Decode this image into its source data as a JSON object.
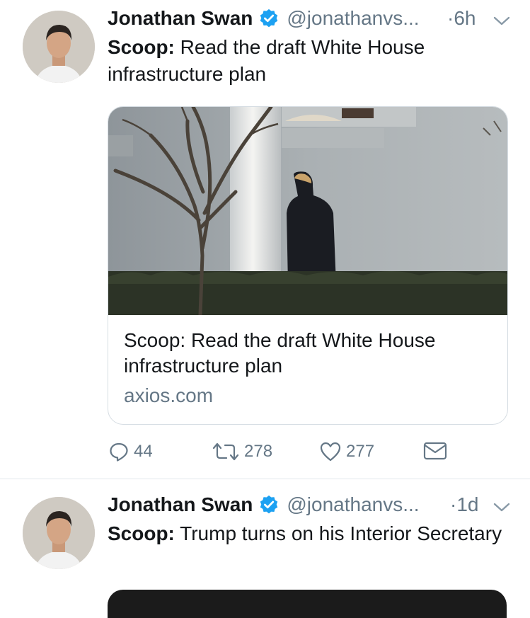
{
  "tweets": [
    {
      "author_name": "Jonathan Swan",
      "handle": "@jonathanvs...",
      "time": "·6h",
      "text_bold": "Scoop:",
      "text_rest": " Read the draft White House infrastructure plan",
      "card": {
        "title": "Scoop: Read the draft White House infrastructure plan",
        "domain": "axios.com"
      },
      "actions": {
        "reply_count": "44",
        "retweet_count": "278",
        "like_count": "277"
      }
    },
    {
      "author_name": "Jonathan Swan",
      "handle": "@jonathanvs...",
      "time": "·1d",
      "text_bold": "Scoop:",
      "text_rest": " Trump turns on his Interior Secretary"
    }
  ],
  "icons": {
    "verified": "verified-badge-icon",
    "caret": "chevron-down-icon",
    "reply": "reply-icon",
    "retweet": "retweet-icon",
    "like": "heart-icon",
    "dm": "envelope-icon"
  },
  "colors": {
    "accent": "#1da1f2",
    "secondary_text": "#657786",
    "divider": "#e1e8ed"
  }
}
